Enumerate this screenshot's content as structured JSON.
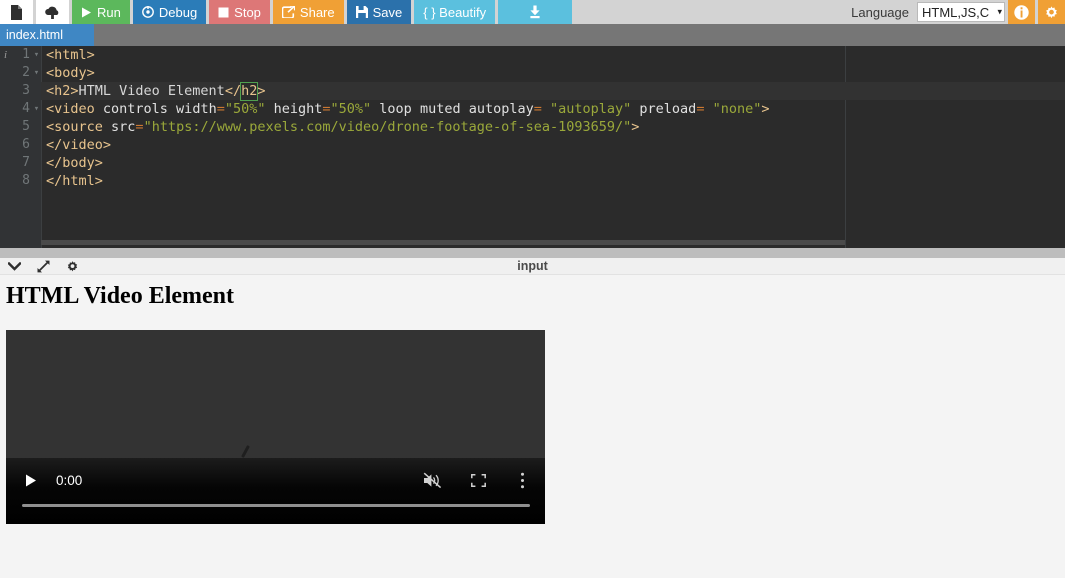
{
  "toolbar": {
    "new_file_icon": "document-icon",
    "upload_icon": "cloud-upload-icon",
    "run_label": "Run",
    "run_icon": "play-icon",
    "debug_label": "Debug",
    "debug_icon": "debug-target-icon",
    "stop_label": "Stop",
    "stop_icon": "stop-square-icon",
    "share_label": "Share",
    "share_icon": "share-external-icon",
    "save_label": "Save",
    "save_icon": "floppy-disk-icon",
    "beautify_label": "{ } Beautify",
    "download_icon": "download-icon",
    "language_label": "Language",
    "language_value": "HTML,JS,C",
    "language_caret": "▾",
    "info_icon": "info-circle-icon",
    "settings_icon": "gear-icon",
    "colors": {
      "run": "#5cb85c",
      "debug": "#2b7cb8",
      "stop": "#dd7777",
      "share": "#f0a035",
      "save": "#2b71ab",
      "beautify": "#5bc0de",
      "download": "#5bc0de",
      "accent_orange": "#f0a035",
      "tab_active": "#3f87c4"
    }
  },
  "tabs": [
    {
      "label": "index.html",
      "active": true
    }
  ],
  "editor": {
    "background": "#2b2b2b",
    "gutter_background": "#313335",
    "info_marker": "i",
    "fold_glyph": "▾",
    "active_line": 3,
    "lines": [
      {
        "number": "1",
        "fold": true,
        "info": true,
        "tokens": [
          {
            "t": "tag",
            "s": "<html>"
          }
        ]
      },
      {
        "number": "2",
        "fold": true,
        "tokens": [
          {
            "t": "tag",
            "s": "<body>"
          }
        ]
      },
      {
        "number": "3",
        "fold": false,
        "active": true,
        "tokens": [
          {
            "t": "tag",
            "s": "<h2>"
          },
          {
            "t": "txt",
            "s": "HTML Video Element"
          },
          {
            "t": "tag",
            "s": "</"
          },
          {
            "t": "match",
            "s": "h2"
          },
          {
            "t": "tag",
            "s": ">"
          }
        ]
      },
      {
        "number": "4",
        "fold": true,
        "tokens": [
          {
            "t": "tag",
            "s": "<video"
          },
          {
            "t": "attr",
            "s": " controls width"
          },
          {
            "t": "eq",
            "s": "="
          },
          {
            "t": "str",
            "s": "\"50%\""
          },
          {
            "t": "attr",
            "s": " height"
          },
          {
            "t": "eq",
            "s": "="
          },
          {
            "t": "str",
            "s": "\"50%\""
          },
          {
            "t": "attr",
            "s": " loop muted autoplay"
          },
          {
            "t": "eq",
            "s": "="
          },
          {
            "t": "str",
            "s": " \"autoplay\""
          },
          {
            "t": "attr",
            "s": " preload"
          },
          {
            "t": "eq",
            "s": "="
          },
          {
            "t": "str",
            "s": " \"none\""
          },
          {
            "t": "tag",
            "s": ">"
          }
        ]
      },
      {
        "number": "5",
        "fold": false,
        "tokens": [
          {
            "t": "tag",
            "s": "<source"
          },
          {
            "t": "attr",
            "s": " src"
          },
          {
            "t": "eq",
            "s": "="
          },
          {
            "t": "str",
            "s": "\"https://www.pexels.com/video/drone-footage-of-sea-1093659/\""
          },
          {
            "t": "tag",
            "s": ">"
          }
        ]
      },
      {
        "number": "6",
        "fold": false,
        "tokens": [
          {
            "t": "tag",
            "s": "</video>"
          }
        ]
      },
      {
        "number": "7",
        "fold": false,
        "tokens": [
          {
            "t": "tag",
            "s": "</body>"
          }
        ]
      },
      {
        "number": "8",
        "fold": false,
        "tokens": [
          {
            "t": "tag",
            "s": "</html>"
          }
        ]
      }
    ]
  },
  "output_bar": {
    "collapse_icon": "chevron-down-icon",
    "expand_icon": "expand-diagonal-icon",
    "settings_icon": "gear-icon",
    "title": "input"
  },
  "preview": {
    "heading": "HTML Video Element",
    "video": {
      "background": "#333333",
      "play_icon": "play-icon",
      "current_time": "0:00",
      "mute_icon": "volume-muted-icon",
      "fullscreen_icon": "fullscreen-icon",
      "more_icon": "more-vertical-icon",
      "progress_percent": 0,
      "spinner_icon": "loading-spinner-icon"
    }
  }
}
